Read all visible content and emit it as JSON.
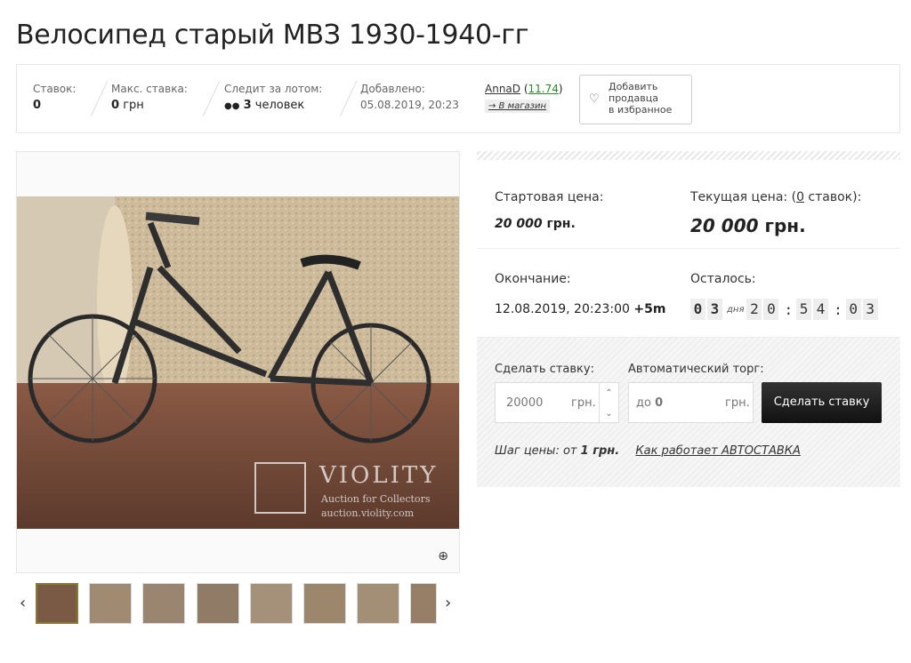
{
  "lot": {
    "title": "Велосипед старый МВЗ 1930-1940-гг"
  },
  "stats": {
    "bids_label": "Ставок:",
    "bids_value": "0",
    "max_bid_label": "Макс. ставка:",
    "max_bid_value": "0",
    "max_bid_unit": "грн",
    "watch_label": "Следит за лотом:",
    "watch_value": "3",
    "watch_unit": "человек",
    "added_label": "Добавлено:",
    "added_value": "05.08.2019, 20:23"
  },
  "seller": {
    "name": "AnnaD",
    "rating": "11.74",
    "shop_link": "→ В магазин"
  },
  "favorite": {
    "label_1": "Добавить",
    "label_2": "продавца",
    "label_3": "в избранное"
  },
  "pricing": {
    "start_label": "Стартовая цена:",
    "start_value": "20 000",
    "start_unit": "грн.",
    "current_label_1": "Текущая цена: (",
    "current_bids": "0",
    "current_label_2": " ставок):",
    "current_value": "20 000",
    "current_unit": "грн."
  },
  "timing": {
    "end_label": "Окончание:",
    "end_value": "12.08.2019, 20:23:00",
    "end_tz": "+5m",
    "left_label": "Осталось:",
    "days_d1": "0",
    "days_d2": "3",
    "days_word": "дня",
    "h1": "2",
    "h2": "0",
    "m1": "5",
    "m2": "4",
    "s1": "0",
    "s2": "3"
  },
  "bid": {
    "make_label": "Сделать ставку:",
    "amount": "20000",
    "unit": "грн.",
    "auto_label": "Автоматический торг:",
    "auto_prefix": "до",
    "auto_value": "0",
    "auto_unit": "грн.",
    "submit": "Сделать ставку",
    "step_label": "Шаг цены:",
    "step_prefix": "от",
    "step_value": "1 грн.",
    "autobid_help": "Как работает АВТОСТАВКА"
  },
  "watermark": {
    "brand": "VIOLITY",
    "tagline": "Auction for Collectors",
    "site": "auction.violity.com"
  },
  "colors": {
    "accent_green": "#2a8a2a",
    "button_dark": "#1a1a1a"
  }
}
